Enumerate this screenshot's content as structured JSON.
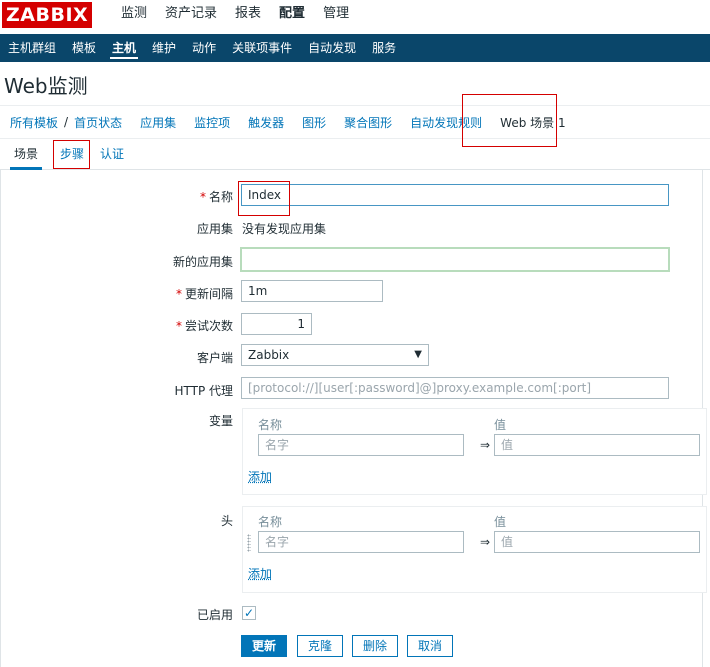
{
  "app": {
    "logo": "ZABBIX"
  },
  "top_menu": [
    {
      "label": "监测"
    },
    {
      "label": "资产记录"
    },
    {
      "label": "报表"
    },
    {
      "label": "配置",
      "active": true
    },
    {
      "label": "管理"
    }
  ],
  "sub_menu": [
    {
      "label": "主机群组"
    },
    {
      "label": "模板"
    },
    {
      "label": "主机",
      "active": true
    },
    {
      "label": "维护"
    },
    {
      "label": "动作"
    },
    {
      "label": "关联项事件"
    },
    {
      "label": "自动发现"
    },
    {
      "label": "服务"
    }
  ],
  "page_title": "Web监测",
  "host_nav": {
    "all_templates": "所有模板",
    "separator": "/",
    "template": "首页状态",
    "applications": "应用集",
    "items": "监控项",
    "triggers": "触发器",
    "graphs": "图形",
    "screens": "聚合图形",
    "discovery": "自动发现规则",
    "web": "Web 场景",
    "web_count": "1"
  },
  "form_tabs": [
    {
      "label": "场景",
      "active": true
    },
    {
      "label": "步骤"
    },
    {
      "label": "认证"
    }
  ],
  "form": {
    "name_label": "名称",
    "name_value": "Index",
    "app_label": "应用集",
    "app_value": "没有发现应用集",
    "new_app_label": "新的应用集",
    "new_app_value": "",
    "interval_label": "更新间隔",
    "interval_value": "1m",
    "attempts_label": "尝试次数",
    "attempts_value": "1",
    "agent_label": "客户端",
    "agent_value": "Zabbix",
    "proxy_label": "HTTP 代理",
    "proxy_placeholder": "[protocol://][user[:password]@]proxy.example.com[:port]",
    "variables_label": "变量",
    "headers_label": "头",
    "col_name": "名称",
    "col_value": "值",
    "name_placeholder": "名字",
    "value_placeholder": "值",
    "arrow": "⇒",
    "add_label": "添加",
    "enabled_label": "已启用",
    "enabled": true
  },
  "buttons": {
    "update": "更新",
    "clone": "克隆",
    "delete": "删除",
    "cancel": "取消"
  }
}
